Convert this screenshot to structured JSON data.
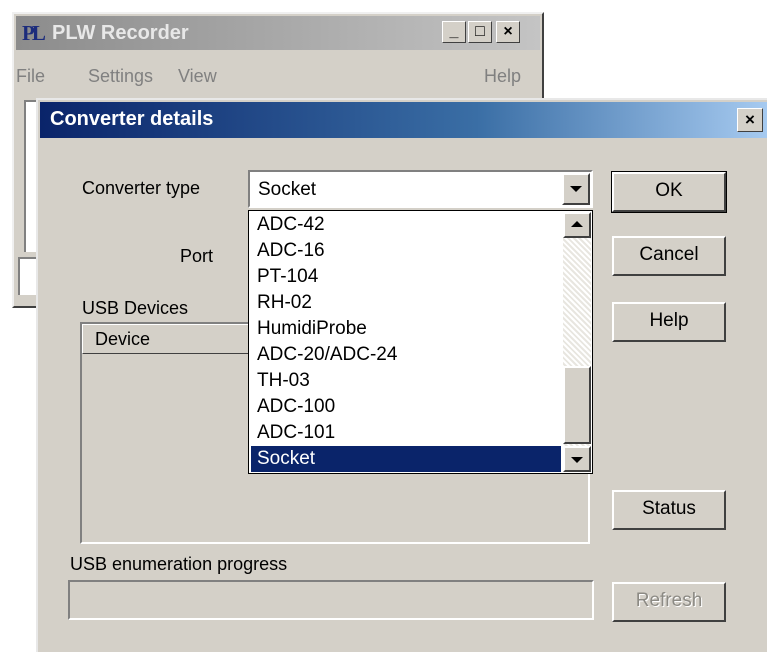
{
  "main_window": {
    "logo_text": "PL",
    "title": "PLW Recorder",
    "controls": {
      "minimize": "_",
      "maximize": "□",
      "close": "×"
    },
    "menu": {
      "file": "File",
      "settings": "Settings",
      "view": "View",
      "help": "Help"
    }
  },
  "dialog": {
    "title": "Converter details",
    "close": "×",
    "converter_type_label": "Converter type",
    "converter_type_value": "Socket",
    "port_label": "Port",
    "usb_devices_label": "USB Devices",
    "device_column": "Device",
    "usb_progress_label": "USB enumeration progress",
    "usb_progress_value": 0,
    "buttons": {
      "ok": "OK",
      "cancel": "Cancel",
      "help": "Help",
      "status": "Status",
      "refresh": "Refresh"
    },
    "dropdown": {
      "items": [
        "ADC-42",
        "ADC-16",
        "PT-104",
        "RH-02",
        "HumidiProbe",
        "ADC-20/ADC-24",
        "TH-03",
        "ADC-100",
        "ADC-101",
        "Socket"
      ],
      "selected": "Socket"
    }
  },
  "colors": {
    "titlebar_active": "#0a246a",
    "face": "#d4d0c8",
    "selection": "#0a246a"
  }
}
